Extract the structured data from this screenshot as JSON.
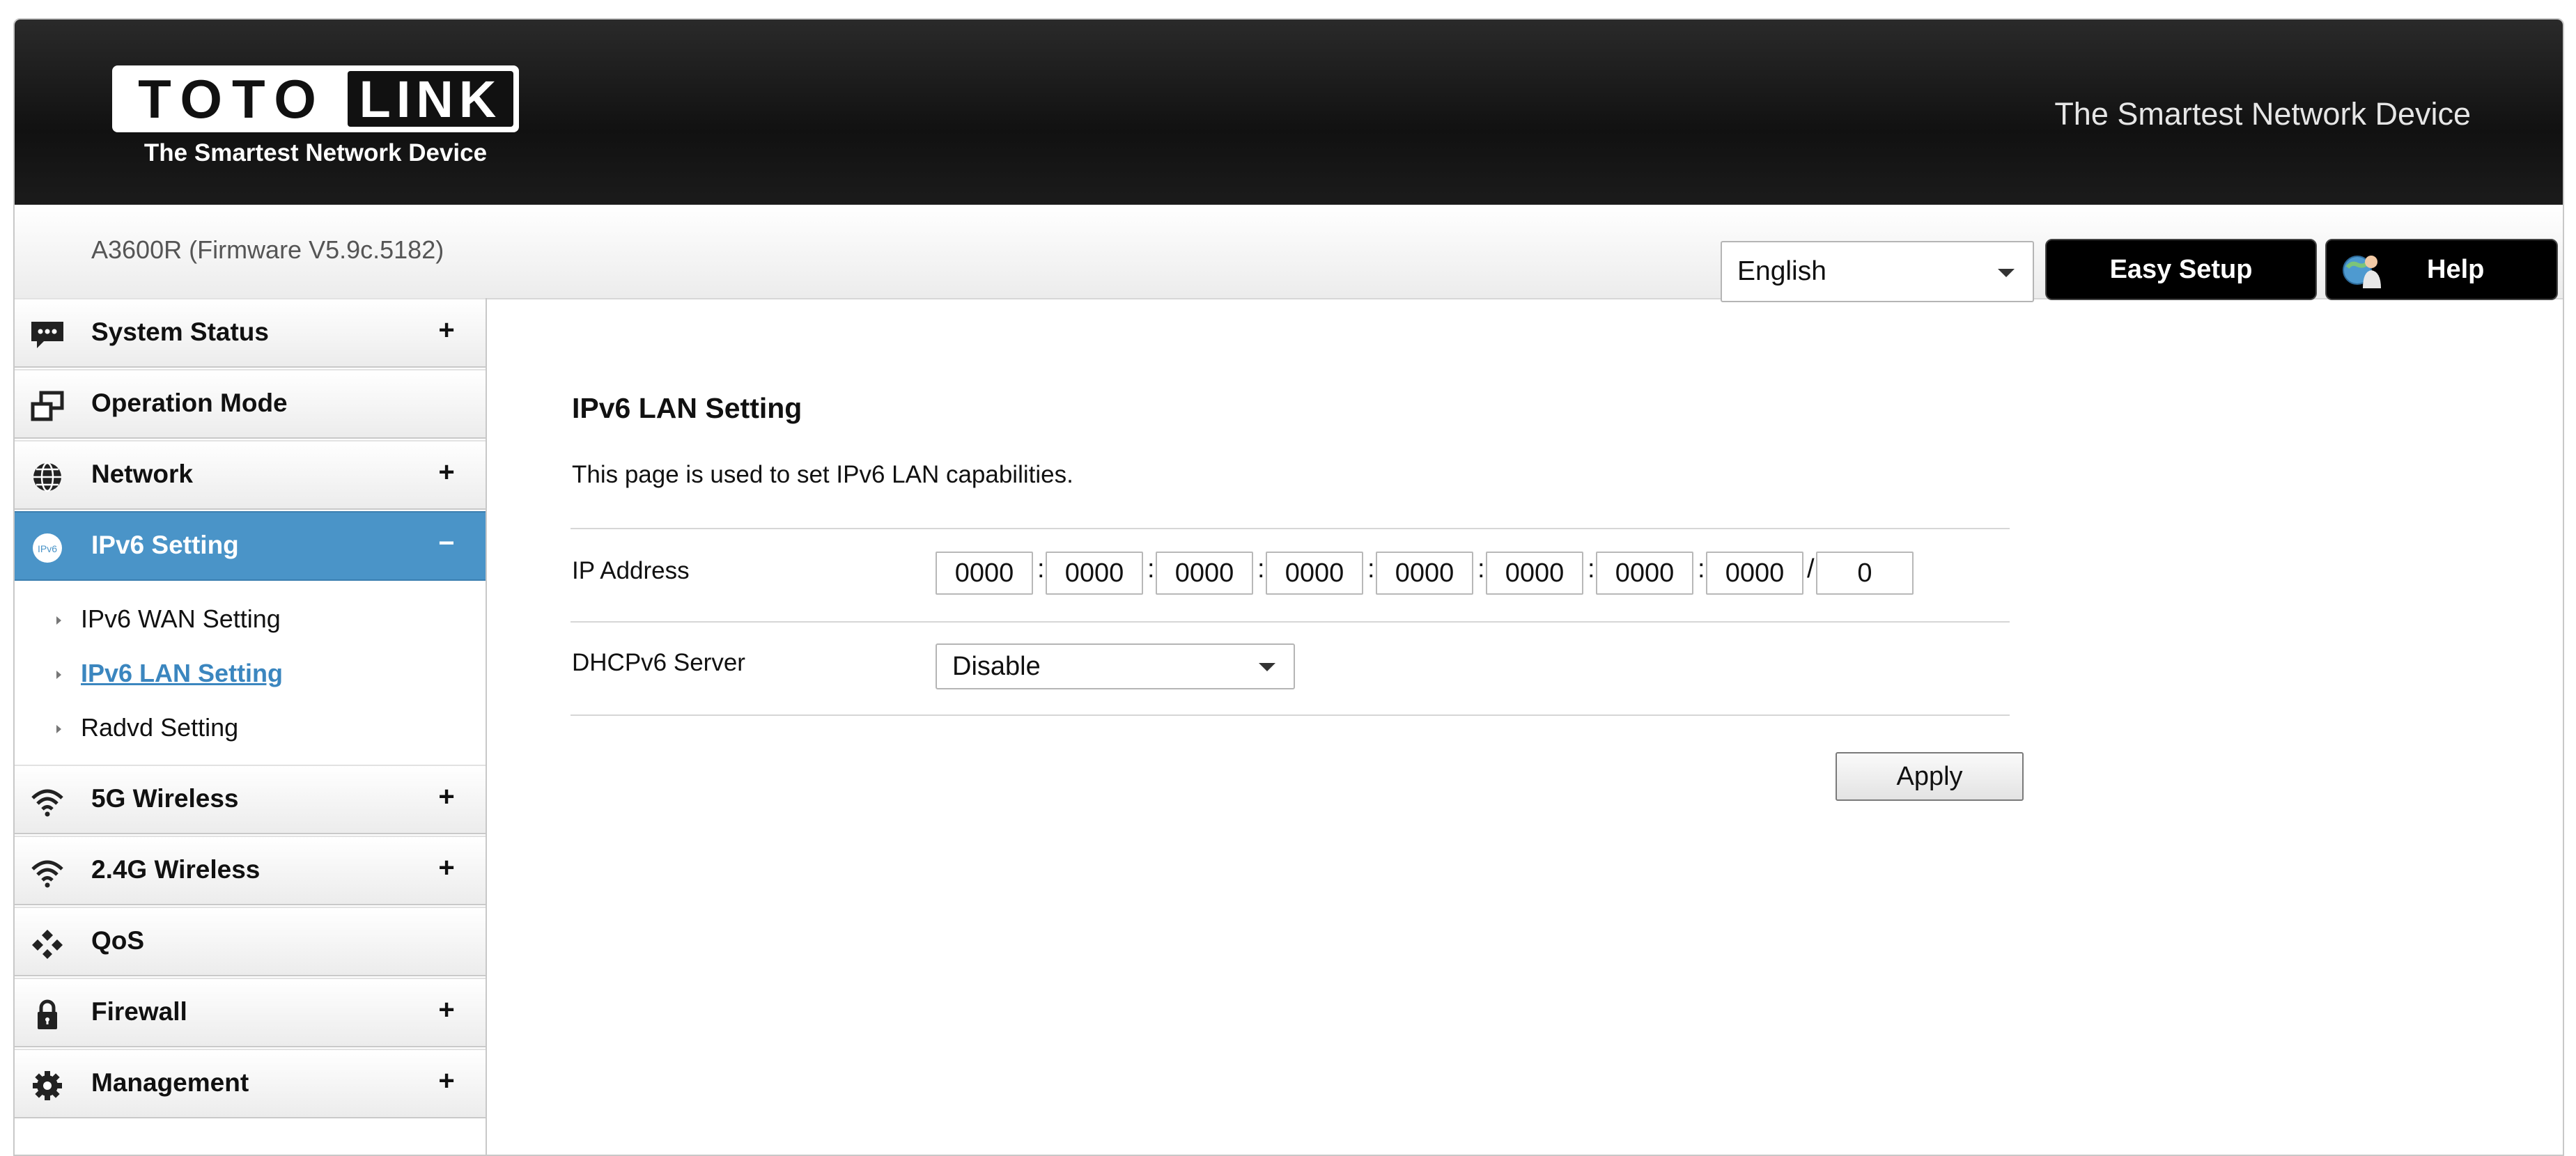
{
  "header": {
    "logo_left": "TOTO",
    "logo_right": "LINK",
    "logo_tagline": "The Smartest Network Device",
    "slogan": "The Smartest Network Device"
  },
  "toolbar": {
    "model": "A3600R (Firmware V5.9c.5182)",
    "language": "English",
    "easy_setup": "Easy Setup",
    "help": "Help"
  },
  "sidebar": {
    "items": [
      {
        "label": "System Status",
        "toggle": "+",
        "icon": "chat-bubble-icon"
      },
      {
        "label": "Operation Mode",
        "toggle": "",
        "icon": "windows-icon"
      },
      {
        "label": "Network",
        "toggle": "+",
        "icon": "globe-icon"
      },
      {
        "label": "IPv6 Setting",
        "toggle": "−",
        "icon": "ipv6-icon",
        "active": true
      },
      {
        "label": "5G Wireless",
        "toggle": "+",
        "icon": "wifi-icon"
      },
      {
        "label": "2.4G Wireless",
        "toggle": "+",
        "icon": "wifi-icon"
      },
      {
        "label": "QoS",
        "toggle": "",
        "icon": "qos-icon"
      },
      {
        "label": "Firewall",
        "toggle": "+",
        "icon": "lock-icon"
      },
      {
        "label": "Management",
        "toggle": "+",
        "icon": "gear-icon"
      }
    ],
    "subitems": [
      {
        "label": "IPv6 WAN Setting"
      },
      {
        "label": "IPv6 LAN Setting",
        "current": true
      },
      {
        "label": "Radvd Setting"
      }
    ]
  },
  "main": {
    "title": "IPv6 LAN Setting",
    "description": "This page is used to set IPv6 LAN capabilities.",
    "ip_label": "IP Address",
    "ip_parts": [
      "0000",
      "0000",
      "0000",
      "0000",
      "0000",
      "0000",
      "0000",
      "0000"
    ],
    "ip_separator": ":",
    "prefix_separator": "/",
    "prefix": "0",
    "dhcp_label": "DHCPv6 Server",
    "dhcp_value": "Disable",
    "apply": "Apply"
  },
  "colors": {
    "accent": "#4a94c8",
    "link": "#3b86bf",
    "header_bg": "#111111"
  }
}
